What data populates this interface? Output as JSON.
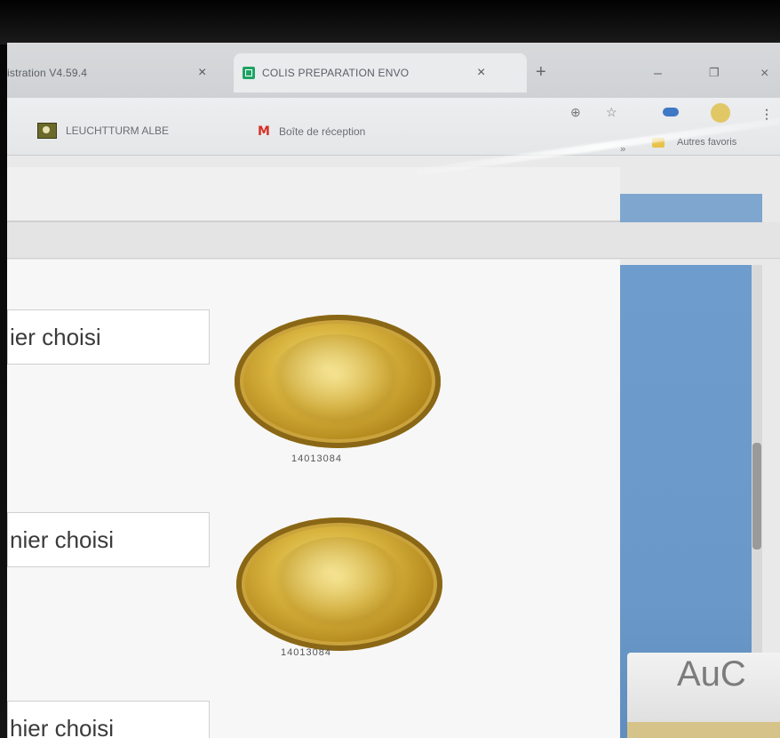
{
  "browser": {
    "tabs": [
      {
        "title": "istration V4.59.4",
        "close": "×"
      },
      {
        "title": "COLIS PREPARATION ENVO",
        "close": "×"
      }
    ],
    "new_tab": "+",
    "window_controls": {
      "minimize": "–",
      "restore": "❐",
      "close": "×"
    }
  },
  "bookmarks": {
    "items": [
      {
        "label": "LEUCHTTURM ALBE",
        "icon": "leuchtturm-icon"
      },
      {
        "label": "Boîte de réception",
        "icon": "gmail-icon",
        "icon_glyph": "M"
      }
    ],
    "overflow": "»",
    "other": "Autres favoris"
  },
  "toolbar_icons": {
    "zoom": "⊕",
    "star": "☆",
    "menu": "⋮"
  },
  "content": {
    "rows": [
      {
        "file_label": "ier choisi",
        "coin_code": "14013084"
      },
      {
        "file_label": "nier choisi",
        "coin_code": "14013084"
      },
      {
        "file_label": "hier choisi"
      }
    ]
  },
  "sticker": {
    "text": "AuC"
  },
  "colors": {
    "tab_strip": "#d7d9db",
    "panel_blue": "#6e9ccd",
    "gold": "#d9b53f",
    "gmail_red": "#d93025"
  }
}
